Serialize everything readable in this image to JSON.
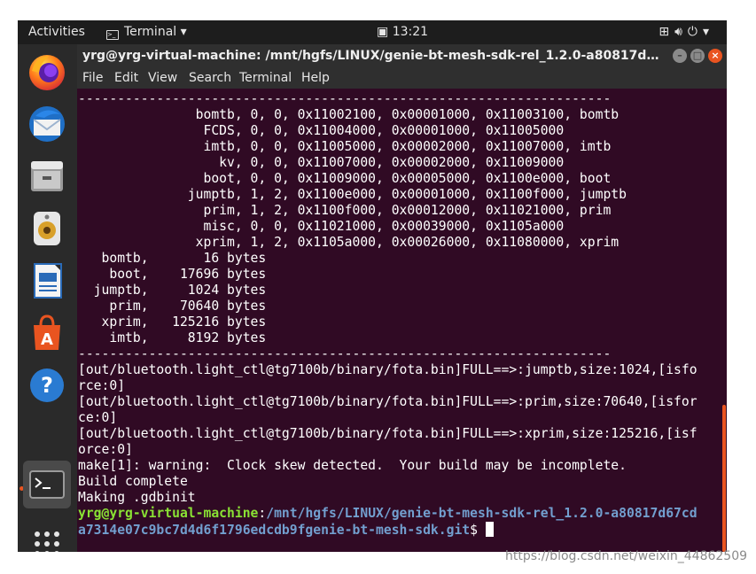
{
  "topbar": {
    "activities": "Activities",
    "app_menu": "Terminal",
    "clock": "13:21",
    "tray_icons": [
      "network-icon",
      "volume-icon",
      "power-icon",
      "chevron-down-icon"
    ]
  },
  "dock": {
    "items": [
      "firefox-icon",
      "thunderbird-icon",
      "files-icon",
      "rhythmbox-icon",
      "writer-icon",
      "software-icon",
      "help-icon",
      "terminal-icon",
      "show-apps-icon"
    ]
  },
  "window": {
    "title": "yrg@yrg-virtual-machine: /mnt/hgfs/LINUX/genie-bt-mesh-sdk-rel_1.2.0-a80817d67cda7314e...",
    "menu": [
      "File",
      "Edit",
      "View",
      "Search",
      "Terminal",
      "Help"
    ]
  },
  "terminal": {
    "lines": [
      "--------------------------------------------------------------------",
      "               bomtb, 0, 0, 0x11002100, 0x00001000, 0x11003100, bomtb",
      "                FCDS, 0, 0, 0x11004000, 0x00001000, 0x11005000",
      "                imtb, 0, 0, 0x11005000, 0x00002000, 0x11007000, imtb",
      "                  kv, 0, 0, 0x11007000, 0x00002000, 0x11009000",
      "                boot, 0, 0, 0x11009000, 0x00005000, 0x1100e000, boot",
      "              jumptb, 1, 2, 0x1100e000, 0x00001000, 0x1100f000, jumptb",
      "                prim, 1, 2, 0x1100f000, 0x00012000, 0x11021000, prim",
      "                misc, 0, 0, 0x11021000, 0x00039000, 0x1105a000",
      "               xprim, 1, 2, 0x1105a000, 0x00026000, 0x11080000, xprim",
      "   bomtb,       16 bytes",
      "    boot,    17696 bytes",
      "  jumptb,     1024 bytes",
      "    prim,    70640 bytes",
      "   xprim,   125216 bytes",
      "    imtb,     8192 bytes",
      "--------------------------------------------------------------------",
      "[out/bluetooth.light_ctl@tg7100b/binary/fota.bin]FULL==>:jumptb,size:1024,[isfo",
      "rce:0]",
      "[out/bluetooth.light_ctl@tg7100b/binary/fota.bin]FULL==>:prim,size:70640,[isfor",
      "ce:0]",
      "[out/bluetooth.light_ctl@tg7100b/binary/fota.bin]FULL==>:xprim,size:125216,[isf",
      "orce:0]",
      "make[1]: warning:  Clock skew detected.  Your build may be incomplete.",
      "Build complete",
      "Making .gdbinit"
    ],
    "prompt_user": "yrg@yrg-virtual-machine",
    "prompt_sep": ":",
    "prompt_path_1": "/mnt/hgfs/LINUX/genie-bt-mesh-sdk-rel_1.2.0-a80817d67cd",
    "prompt_path_2": "a7314e07c9bc7d4d6f1796edcdb9fgenie-bt-mesh-sdk.git",
    "prompt_end": "$ "
  },
  "watermark": "https://blog.csdn.net/weixin_44862509",
  "colors": {
    "terminal_bg": "#300a24",
    "prompt_user": "#8ae234",
    "prompt_path": "#729fcf",
    "accent": "#e95420"
  }
}
